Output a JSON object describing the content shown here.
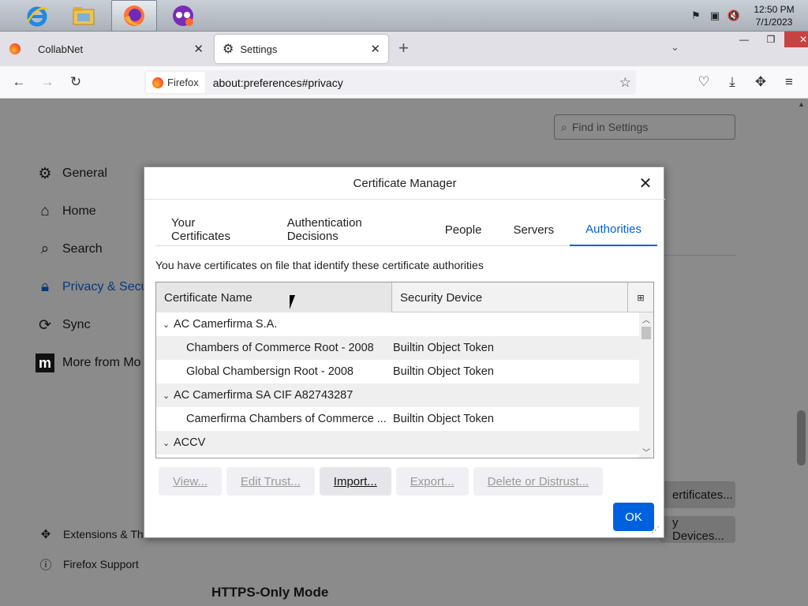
{
  "taskbar": {
    "apps": [
      "internet-explorer",
      "file-explorer",
      "firefox",
      "private-browsing"
    ],
    "clock_time": "12:50 PM",
    "clock_date": "7/1/2023"
  },
  "browser": {
    "tabs": [
      {
        "label": "CollabNet",
        "active": false
      },
      {
        "label": "Settings",
        "active": true
      }
    ],
    "identity_label": "Firefox",
    "url": "about:preferences#privacy"
  },
  "settings_page": {
    "find_placeholder": "Find in Settings",
    "sidebar": [
      {
        "label": "General",
        "icon": "gear-icon"
      },
      {
        "label": "Home",
        "icon": "home-icon"
      },
      {
        "label": "Search",
        "icon": "search-icon"
      },
      {
        "label": "Privacy & Secu",
        "icon": "lock-icon"
      },
      {
        "label": "Sync",
        "icon": "sync-icon"
      },
      {
        "label": "More from Mo",
        "icon": "mozilla-icon"
      }
    ],
    "footer": [
      {
        "label": "Extensions & The",
        "icon": "puzzle-icon"
      },
      {
        "label": "Firefox Support",
        "icon": "help-icon"
      }
    ],
    "bg_buttons": [
      "ertificates...",
      "y Devices..."
    ],
    "https_heading": "HTTPS-Only Mode"
  },
  "dialog": {
    "title": "Certificate Manager",
    "tabs": [
      "Your Certificates",
      "Authentication Decisions",
      "People",
      "Servers",
      "Authorities"
    ],
    "selected_tab": "Authorities",
    "intro": "You have certificates on file that identify these certificate authorities",
    "columns": [
      "Certificate Name",
      "Security Device"
    ],
    "rows": [
      {
        "type": "group",
        "name": "AC Camerfirma S.A.",
        "device": ""
      },
      {
        "type": "child",
        "name": "Chambers of Commerce Root - 2008",
        "device": "Builtin Object Token"
      },
      {
        "type": "child",
        "name": "Global Chambersign Root - 2008",
        "device": "Builtin Object Token"
      },
      {
        "type": "group",
        "name": "AC Camerfirma SA CIF A82743287",
        "device": ""
      },
      {
        "type": "child",
        "name": "Camerfirma Chambers of Commerce ...",
        "device": "Builtin Object Token"
      },
      {
        "type": "group",
        "name": "ACCV",
        "device": ""
      }
    ],
    "buttons": {
      "view": "View...",
      "edit_trust": "Edit Trust...",
      "import": "Import...",
      "export": "Export...",
      "delete": "Delete or Distrust...",
      "ok": "OK"
    }
  }
}
